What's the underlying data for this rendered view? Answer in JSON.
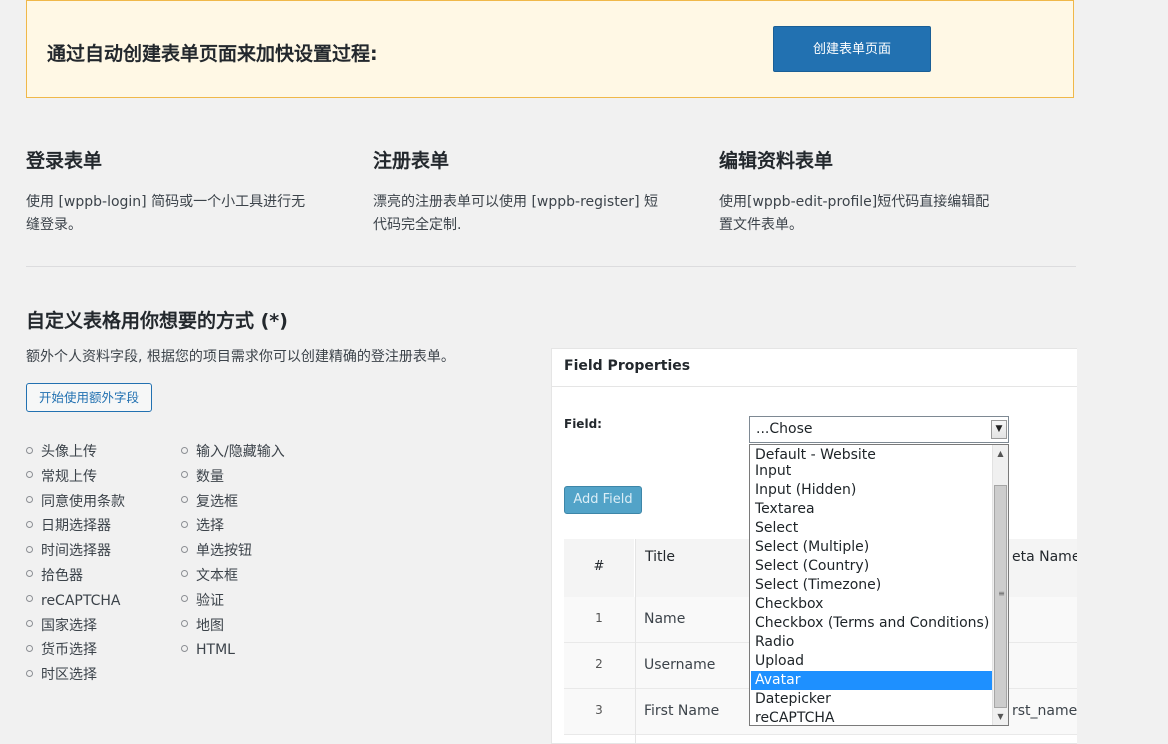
{
  "notice": {
    "text": "通过自动创建表单页面来加快设置过程:",
    "button": "创建表单页面"
  },
  "columns": [
    {
      "title": "登录表单",
      "desc_line1": "使用 [wppb-login] 简码或一个小工具进行无",
      "desc_line2": "缝登录。"
    },
    {
      "title": "注册表单",
      "desc_line1": "漂亮的注册表单可以使用 [wppb-register] 短",
      "desc_line2": "代码完全定制."
    },
    {
      "title": "编辑资料表单",
      "desc_line1": "使用[wppb-edit-profile]短代码直接编辑配",
      "desc_line2": "置文件表单。"
    }
  ],
  "custom": {
    "title": "自定义表格用你想要的方式 (*)",
    "desc": "额外个人资料字段, 根据您的项目需求你可以创建精确的登注册表单。",
    "button": "开始使用额外字段",
    "list_left": [
      "头像上传",
      "常规上传",
      "同意使用条款",
      "日期选择器",
      "时间选择器",
      "拾色器",
      "reCAPTCHA",
      "国家选择",
      "货币选择",
      "时区选择"
    ],
    "list_right": [
      "输入/隐藏输入",
      "数量",
      "复选框",
      "选择",
      "单选按钮",
      "文本框",
      "验证",
      "地图",
      "HTML"
    ]
  },
  "panel": {
    "heading": "Field Properties",
    "field_label": "Field:",
    "add_button": "Add Field",
    "table": {
      "col_num": "#",
      "col_title": "Title",
      "col_meta": "eta Name",
      "rows": [
        {
          "num": "1",
          "title": "Name",
          "meta": ""
        },
        {
          "num": "2",
          "title": "Username",
          "meta": ""
        },
        {
          "num": "3",
          "title": "First Name",
          "meta": "rst_name"
        }
      ]
    }
  },
  "select": {
    "value": "...Chose",
    "options": [
      "Default - Website",
      "Input",
      "Input (Hidden)",
      "Textarea",
      "Select",
      "Select (Multiple)",
      "Select (Country)",
      "Select (Timezone)",
      "Checkbox",
      "Checkbox (Terms and Conditions)",
      "Radio",
      "Upload",
      "Avatar",
      "Datepicker",
      "reCAPTCHA"
    ],
    "highlighted": "Avatar",
    "icons": {
      "arrow": "chevron-down-icon",
      "scroll_up": "scroll-up-arrow-icon",
      "scroll_down": "scroll-down-arrow-icon",
      "grip": "scrollbar-grip-icon"
    }
  },
  "colors": {
    "accent": "#2271b1",
    "notice_bg": "#fff8e5",
    "notice_border": "#f0b849",
    "highlight": "#1e90ff"
  }
}
